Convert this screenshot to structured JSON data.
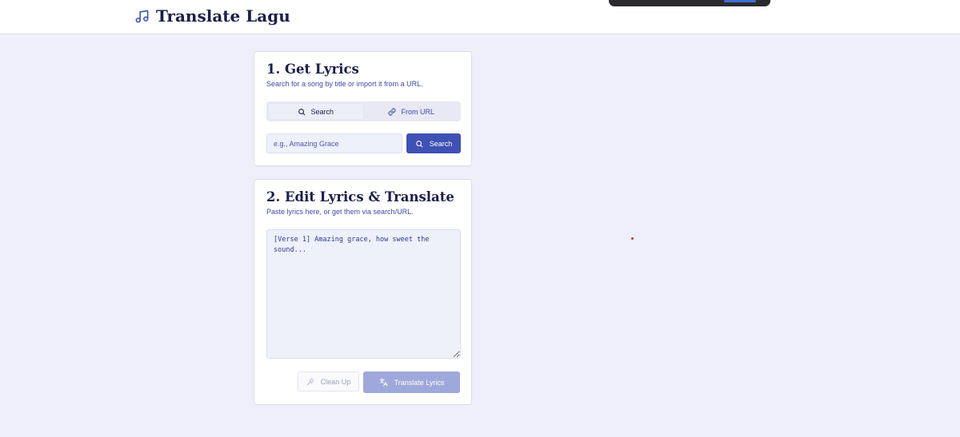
{
  "app": {
    "title": "Translate Lagu"
  },
  "icons": {
    "brand": "music-note-icon",
    "search": "search-icon",
    "link": "link-icon",
    "wand": "magic-wand-icon",
    "translate": "translate-icon"
  },
  "colors": {
    "accent": "#3f51b5",
    "accent_disabled": "#9fa8da",
    "background": "#eeeffa"
  },
  "get_lyrics": {
    "title": "1. Get Lyrics",
    "subtitle": "Search for a song by title or import it from a URL.",
    "tabs": [
      {
        "label": "Search",
        "active": true
      },
      {
        "label": "From URL",
        "active": false
      }
    ],
    "search_placeholder": "e.g., Amazing Grace",
    "search_button": "Search"
  },
  "edit_lyrics": {
    "title": "2. Edit Lyrics & Translate",
    "subtitle": "Paste lyrics here, or get them via search/URL.",
    "lyrics_placeholder": "[Verse 1] Amazing grace, how sweet the sound...",
    "cleanup_button": "Clean Up",
    "translate_button": "Translate Lyrics"
  }
}
